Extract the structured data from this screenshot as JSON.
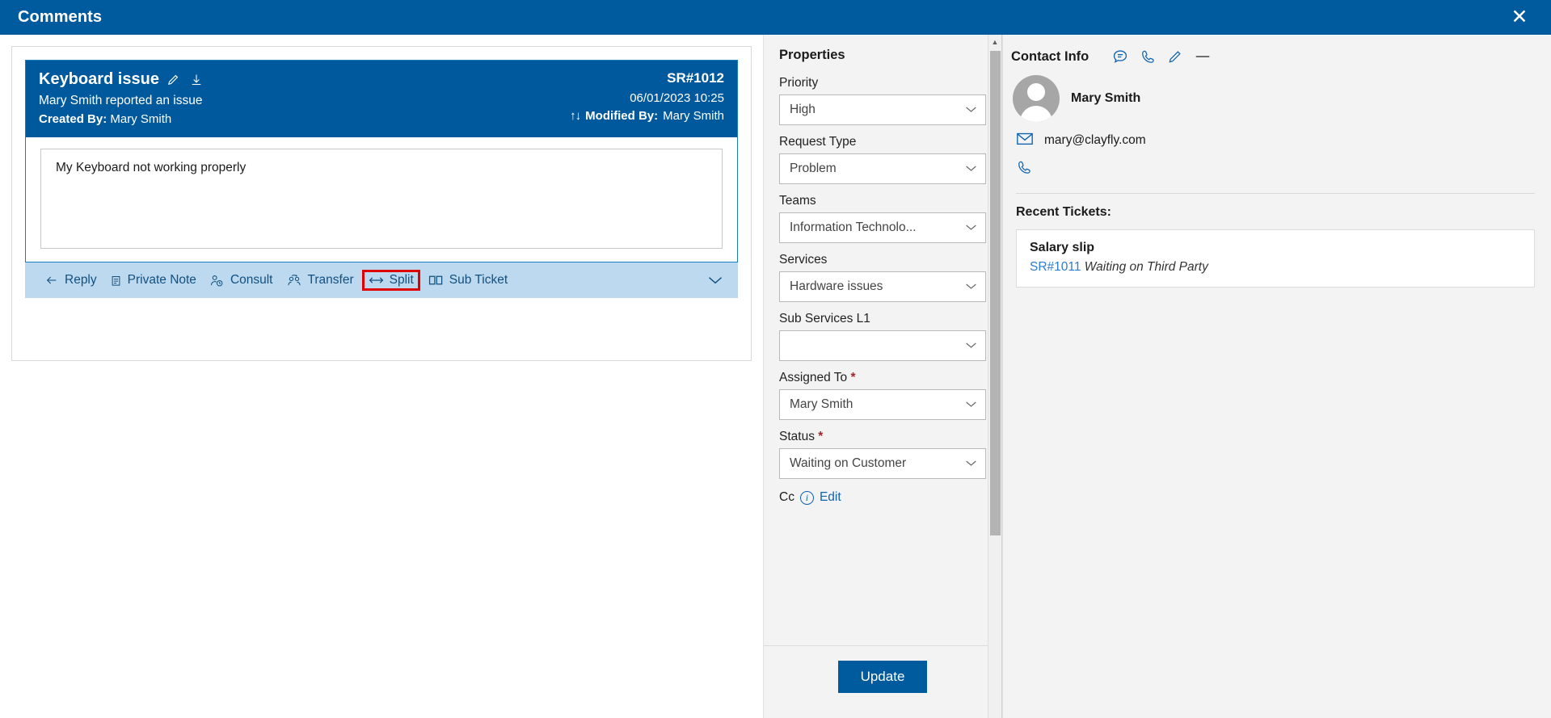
{
  "titlebar": {
    "title": "Comments",
    "close_icon": "close-icon"
  },
  "thread": {
    "message": {
      "title": "Keyboard issue",
      "edit_icon": "pencil-icon",
      "download_icon": "download-icon",
      "subtitle": "Mary Smith reported an issue",
      "created_by_label": "Created By:",
      "created_by_value": "Mary Smith",
      "ticket_id": "SR#1012",
      "timestamp": "06/01/2023 10:25",
      "sort_arrows": "↑↓",
      "modified_by_label": "Modified By:",
      "modified_by_value": "Mary Smith",
      "body": "My Keyboard not working properly"
    },
    "toolbar": {
      "items": [
        {
          "label": "Reply",
          "icon": "back-arrow-icon",
          "highlighted": false
        },
        {
          "label": "Private Note",
          "icon": "note-icon",
          "highlighted": false
        },
        {
          "label": "Consult",
          "icon": "person-clock-icon",
          "highlighted": false
        },
        {
          "label": "Transfer",
          "icon": "people-transfer-icon",
          "highlighted": false
        },
        {
          "label": "Split",
          "icon": "split-arrows-icon",
          "highlighted": true
        },
        {
          "label": "Sub Ticket",
          "icon": "columns-icon",
          "highlighted": false
        }
      ],
      "expand_icon": "chevron-down-icon",
      "highlight_color": "#e00000",
      "background": "#bcd9ef"
    }
  },
  "properties": {
    "title": "Properties",
    "fields": [
      {
        "label": "Priority",
        "value": "High",
        "required": false
      },
      {
        "label": "Request Type",
        "value": "Problem",
        "required": false
      },
      {
        "label": "Teams",
        "value": "Information Technolo...",
        "required": false
      },
      {
        "label": "Services",
        "value": "Hardware issues",
        "required": false
      },
      {
        "label": "Sub Services L1",
        "value": "",
        "required": false
      },
      {
        "label": "Assigned To",
        "value": "Mary Smith",
        "required": true
      },
      {
        "label": "Status",
        "value": "Waiting on Customer",
        "required": true
      }
    ],
    "cc": {
      "label": "Cc",
      "info_icon": "info-icon",
      "edit_label": "Edit"
    },
    "update_button": "Update",
    "accent_color": "#005a9e"
  },
  "contact_info": {
    "title": "Contact Info",
    "header_icons": [
      {
        "name": "chat-icon"
      },
      {
        "name": "phone-icon"
      },
      {
        "name": "pencil-icon"
      },
      {
        "name": "minimize-icon"
      }
    ],
    "person": {
      "name": "Mary Smith",
      "avatar_icon": "avatar-icon",
      "email": "mary@clayfly.com",
      "email_icon": "envelope-icon",
      "phone": "",
      "phone_icon": "phone-icon"
    },
    "recent_tickets_label": "Recent Tickets:",
    "recent_tickets": [
      {
        "title": "Salary slip",
        "id": "SR#1011",
        "status": "Waiting on Third Party"
      }
    ]
  }
}
